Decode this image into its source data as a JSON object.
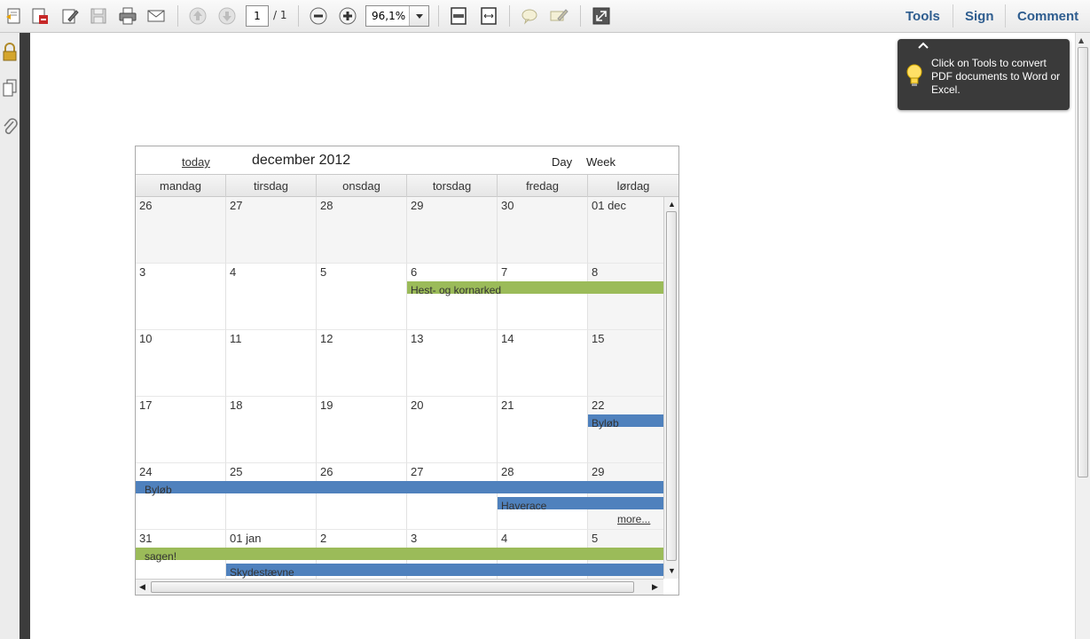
{
  "toolbar": {
    "page_current": "1",
    "page_total": "/ 1",
    "zoom": "96,1%",
    "tools_label": "Tools",
    "sign_label": "Sign",
    "comment_label": "Comment"
  },
  "tooltip": {
    "text": "Click on Tools to convert PDF documents to Word or Excel."
  },
  "calendar": {
    "today_label": "today",
    "title": "december 2012",
    "day_label": "Day",
    "week_label": "Week",
    "day_names": [
      "mandag",
      "tirsdag",
      "onsdag",
      "torsdag",
      "fredag",
      "lørdag"
    ],
    "weeks": [
      [
        "26",
        "27",
        "28",
        "29",
        "30",
        "01 dec"
      ],
      [
        "3",
        "4",
        "5",
        "6",
        "7",
        "8"
      ],
      [
        "10",
        "11",
        "12",
        "13",
        "14",
        "15"
      ],
      [
        "17",
        "18",
        "19",
        "20",
        "21",
        "22"
      ],
      [
        "24",
        "25",
        "26",
        "27",
        "28",
        "29"
      ],
      [
        "31",
        "01 jan",
        "2",
        "3",
        "4",
        "5"
      ]
    ],
    "events": {
      "hest": "Hest- og kornarked",
      "bylob1": "Byløb",
      "bylob2": "Byløb",
      "haverace": "Haverace",
      "sagen": "sagen!",
      "skyde": "Skydestævne"
    },
    "more_label": "more..."
  },
  "colors": {
    "event_green": "#9bbb59",
    "event_blue": "#4f81bd",
    "toolbar_link": "#2e5d8f"
  }
}
